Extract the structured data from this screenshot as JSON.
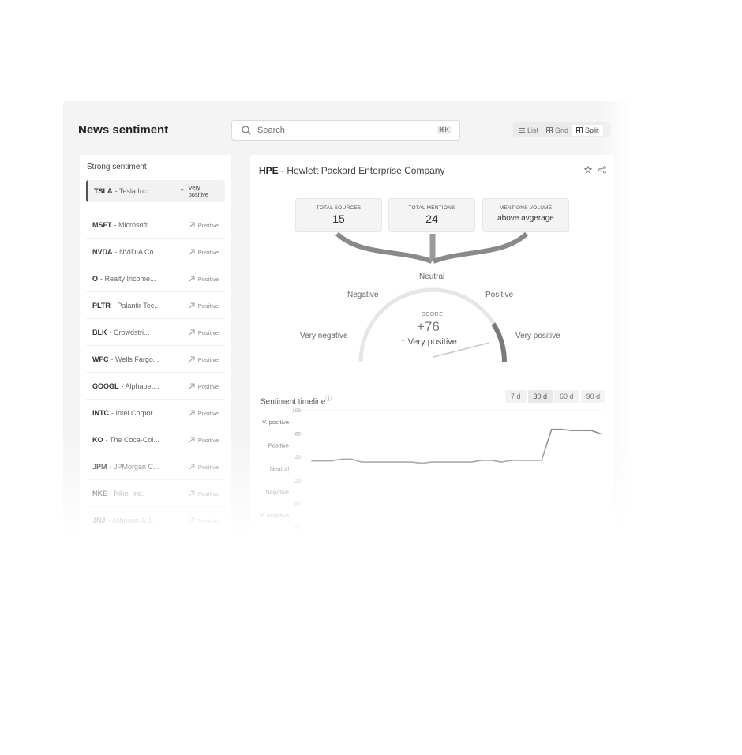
{
  "app": {
    "title": "News sentiment",
    "search": {
      "placeholder": "Search",
      "shortcut": "⌘K"
    },
    "views": [
      {
        "label": "List",
        "icon": "list-icon",
        "active": false
      },
      {
        "label": "Grid",
        "icon": "grid-icon",
        "active": false
      },
      {
        "label": "Split",
        "icon": "split-icon",
        "active": true
      }
    ]
  },
  "sidebar": {
    "header": "Strong sentiment",
    "selected": {
      "ticker": "TSLA",
      "name": "Tesla Inc",
      "sentiment": "Very positive"
    },
    "items": [
      {
        "ticker": "MSFT",
        "name": "Microsoft...",
        "sentiment": "Positive"
      },
      {
        "ticker": "NVDA",
        "name": "NVIDIA Co...",
        "sentiment": "Positive"
      },
      {
        "ticker": "O",
        "name": "Realty Income...",
        "sentiment": "Positive"
      },
      {
        "ticker": "PLTR",
        "name": "Palantir Tec...",
        "sentiment": "Positive"
      },
      {
        "ticker": "BLK",
        "name": "Crowdstri...",
        "sentiment": "Positive"
      },
      {
        "ticker": "WFC",
        "name": "Wells Fargo...",
        "sentiment": "Positive"
      },
      {
        "ticker": "GOOGL",
        "name": "Alphabet...",
        "sentiment": "Positive"
      },
      {
        "ticker": "INTC",
        "name": "Intel Corpor...",
        "sentiment": "Positive"
      },
      {
        "ticker": "KO",
        "name": "The Coca-Col...",
        "sentiment": "Positive"
      },
      {
        "ticker": "JPM",
        "name": "JPMorgan C...",
        "sentiment": "Positive"
      },
      {
        "ticker": "NKE",
        "name": "Nike, Inc.",
        "sentiment": "Positive"
      },
      {
        "ticker": "JNJ",
        "name": "Johnson & J...",
        "sentiment": "Positive"
      }
    ]
  },
  "detail": {
    "ticker": "HPE",
    "name": "Hewlett Packard Enterprise Company",
    "stats": [
      {
        "label": "TOTAL SOURCES",
        "value": "15"
      },
      {
        "label": "TOTAL MENTIONS",
        "value": "24"
      },
      {
        "label": "MENTIONS VOLUME",
        "value": "above avgerage"
      }
    ],
    "gauge": {
      "labels": {
        "neutral": "Neutral",
        "negative": "Negative",
        "positive": "Positive",
        "very_negative": "Very negative",
        "very_positive": "Very positive"
      },
      "score_label": "SCORE",
      "score": "+76",
      "score_value": 76,
      "descriptor": "Very positive"
    },
    "timeline": {
      "title": "Sentiment timeline",
      "ranges": [
        "7 d",
        "30 d",
        "60 d",
        "90 d"
      ],
      "active_range": "30 d"
    }
  },
  "chart_data": {
    "type": "line",
    "title": "Sentiment timeline",
    "y_ticks": [
      100,
      60,
      20,
      -20,
      -60,
      -100
    ],
    "y_categories": [
      "V. positive",
      "Positive",
      "Neutral",
      "Negative",
      "V. negative"
    ],
    "ylim": [
      -100,
      100
    ],
    "x": [
      0,
      1,
      2,
      3,
      4,
      5,
      6,
      7,
      8,
      9,
      10,
      11,
      12,
      13,
      14,
      15,
      16,
      17,
      18,
      19,
      20,
      21,
      22,
      23,
      24,
      25,
      26,
      27,
      28,
      29
    ],
    "series": [
      {
        "values": [
          14,
          14,
          14,
          17,
          17,
          12,
          12,
          12,
          12,
          12,
          12,
          10,
          12,
          12,
          12,
          12,
          12,
          15,
          15,
          12,
          15,
          15,
          15,
          15,
          68,
          68,
          66,
          66,
          66,
          60
        ]
      }
    ]
  }
}
